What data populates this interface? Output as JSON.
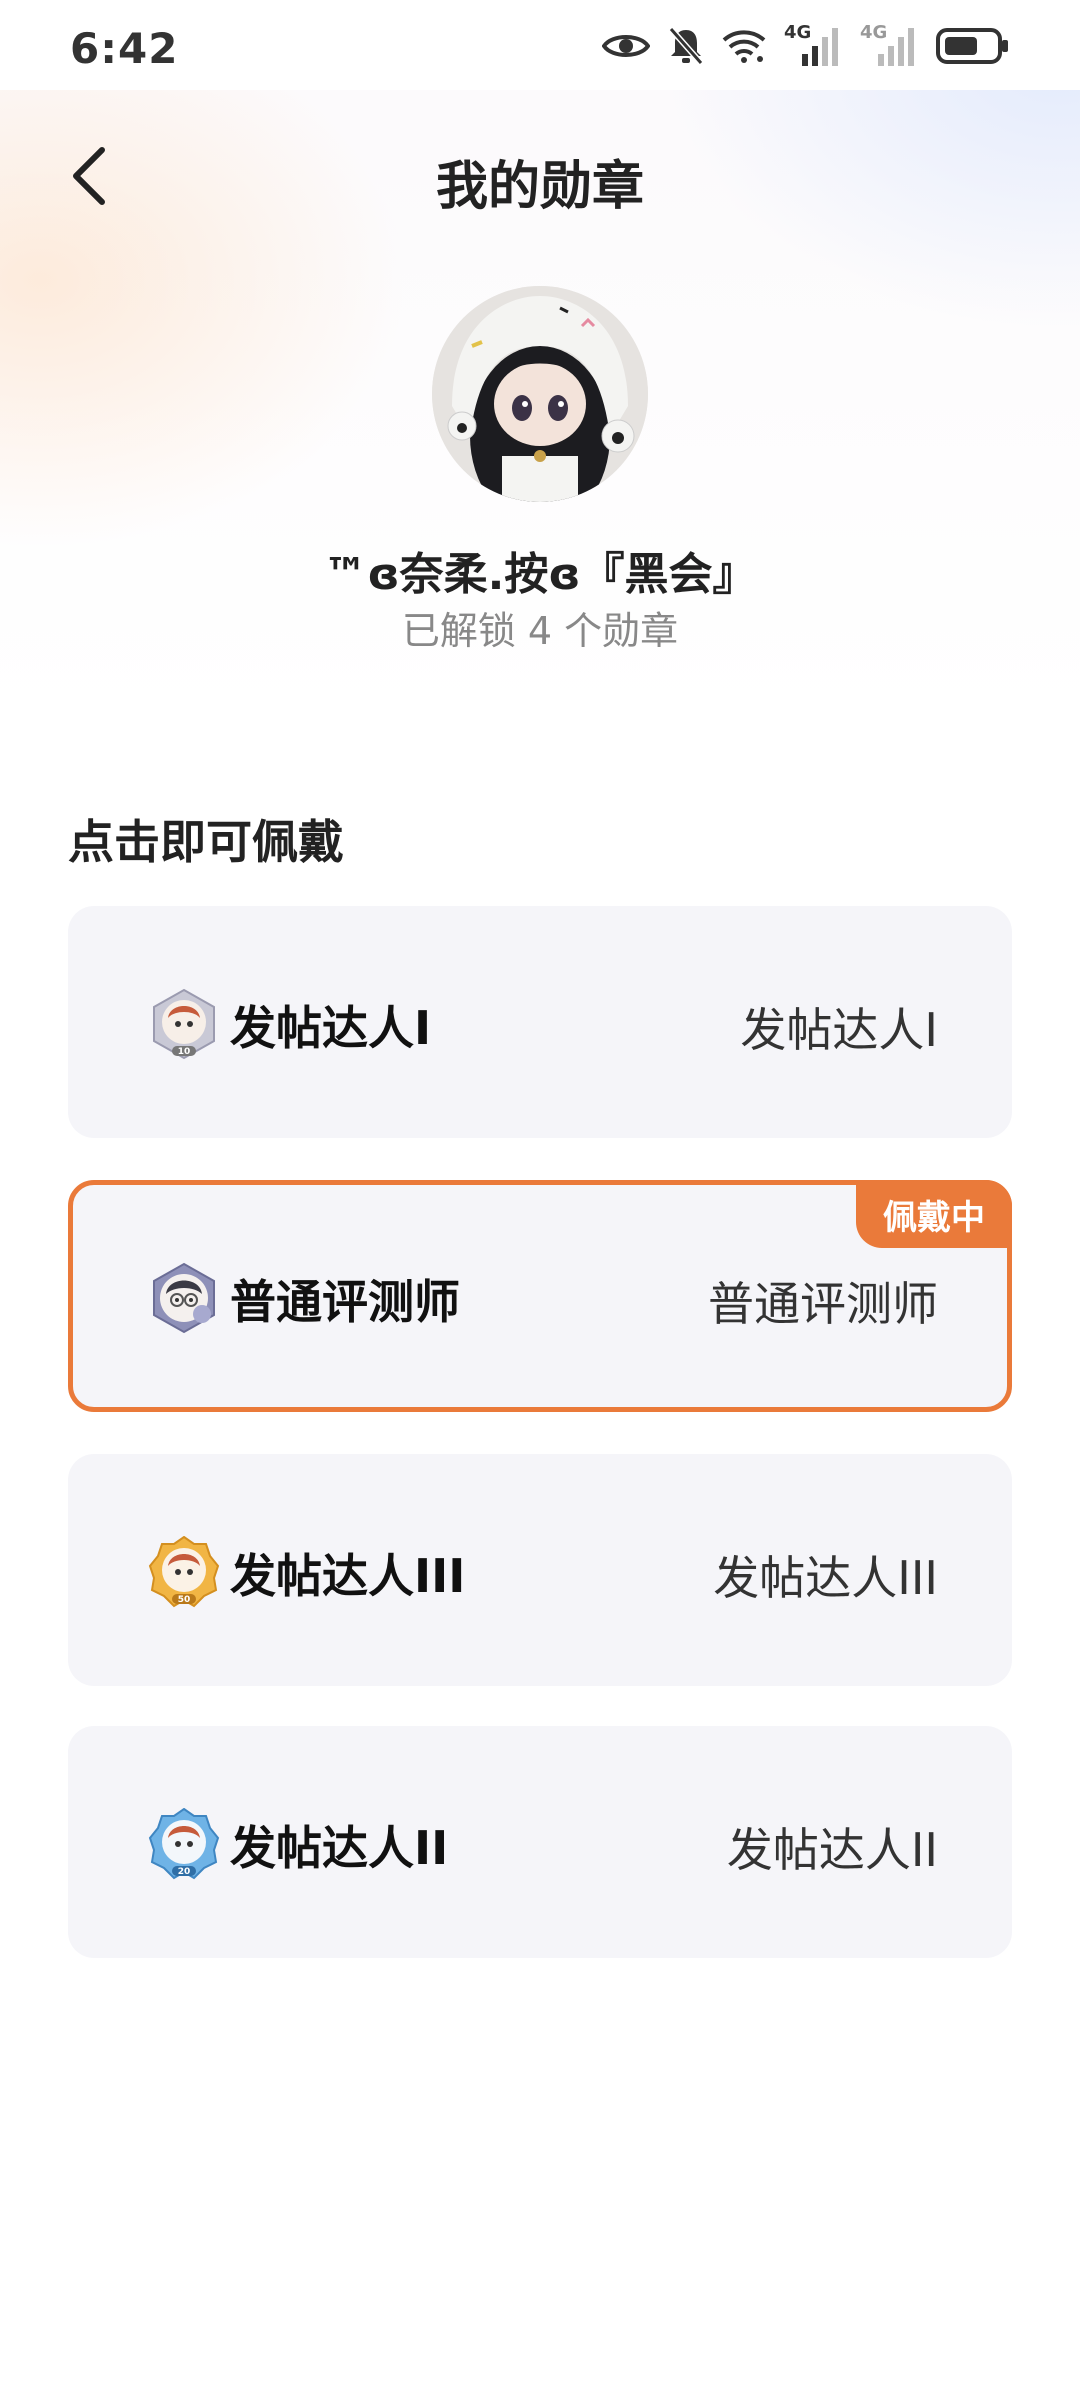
{
  "status_bar": {
    "time": "6:42",
    "icons": [
      "eye-icon",
      "bell-off-icon",
      "wifi-icon",
      "signal-4g-icon",
      "signal-4g-icon",
      "battery-icon"
    ],
    "network_label_1": "4G",
    "network_label_2": "4G"
  },
  "header": {
    "title": "我的勋章",
    "back_icon": "chevron-left-icon"
  },
  "profile": {
    "name": "™ɞ奈柔.按ɞ『黑会』",
    "unlock_text": "已解锁 4 个勋章"
  },
  "section_title": "点击即可佩戴",
  "colors": {
    "accent": "#ea7a3a",
    "card_bg": "#f5f5f9"
  },
  "medals": [
    {
      "name": "发帖达人I",
      "description": "发帖达人I",
      "level_label": "10",
      "wearing": false,
      "badge_color": "#c9c9d6",
      "icon": "medal-postmaster-1-icon"
    },
    {
      "name": "普通评测师",
      "description": "普通评测师",
      "level_label": "",
      "wearing": true,
      "wearing_label": "佩戴中",
      "badge_color": "#8e90b8",
      "icon": "medal-reviewer-icon"
    },
    {
      "name": "发帖达人III",
      "description": "发帖达人III",
      "level_label": "50",
      "wearing": false,
      "badge_color": "#f1b544",
      "icon": "medal-postmaster-3-icon"
    },
    {
      "name": "发帖达人II",
      "description": "发帖达人II",
      "level_label": "20",
      "wearing": false,
      "badge_color": "#6fb3e6",
      "icon": "medal-postmaster-2-icon"
    }
  ]
}
